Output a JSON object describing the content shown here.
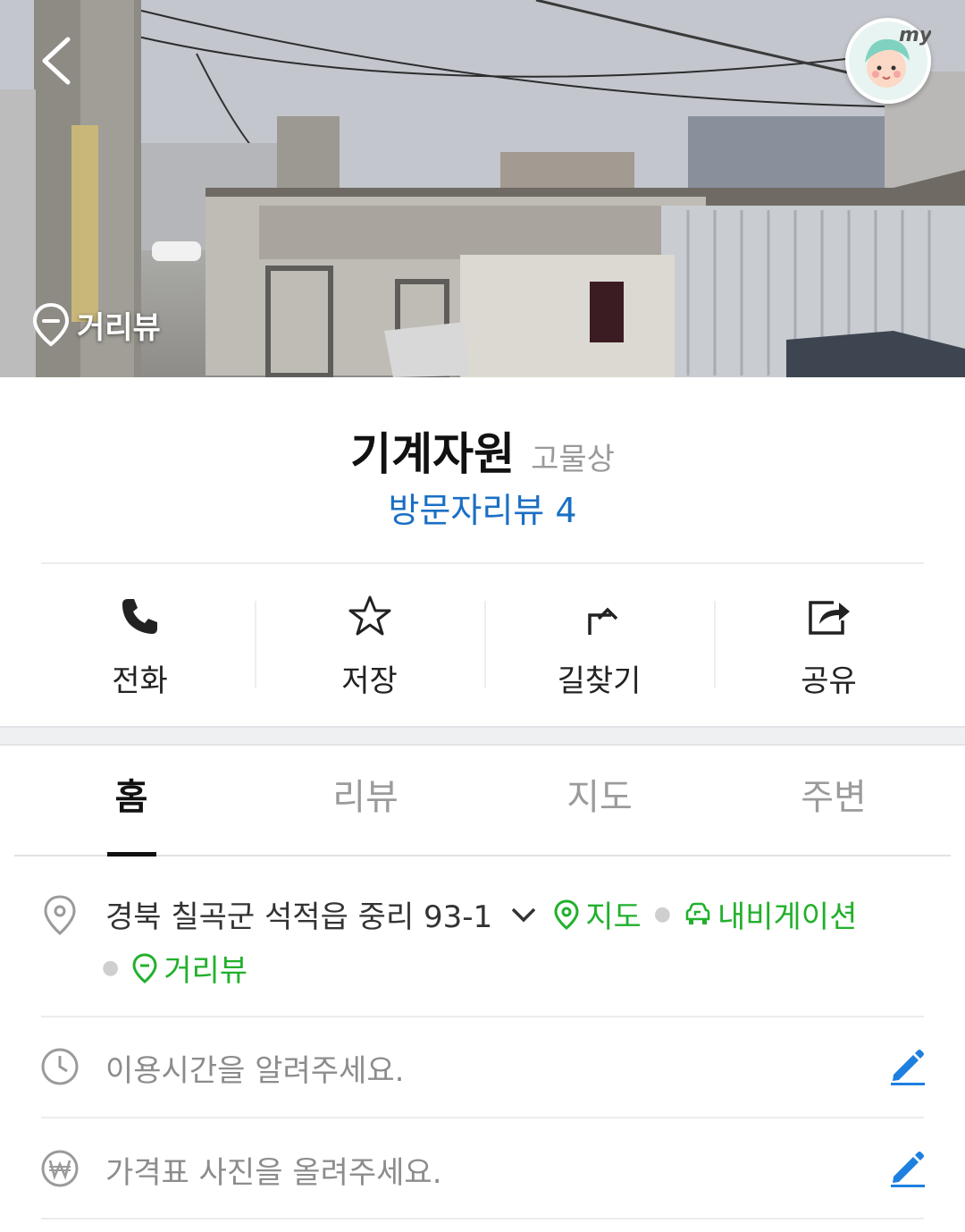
{
  "hero": {
    "streetview_label": "거리뷰",
    "my_badge": "my"
  },
  "place": {
    "name": "기계자원",
    "category": "고물상",
    "review_link": "방문자리뷰 4"
  },
  "actions": [
    {
      "label": "전화",
      "icon": "phone-icon"
    },
    {
      "label": "저장",
      "icon": "star-icon"
    },
    {
      "label": "길찾기",
      "icon": "directions-icon"
    },
    {
      "label": "공유",
      "icon": "share-icon"
    }
  ],
  "tabs": [
    {
      "label": "홈",
      "active": true
    },
    {
      "label": "리뷰",
      "active": false
    },
    {
      "label": "지도",
      "active": false
    },
    {
      "label": "주변",
      "active": false
    }
  ],
  "address": {
    "text": "경북 칠곡군 석적읍 중리 93-1",
    "map_link": "지도",
    "navigation_link": "내비게이션",
    "streetview_link": "거리뷰"
  },
  "hours": {
    "prompt": "이용시간을 알려주세요."
  },
  "price": {
    "prompt": "가격표 사진을 올려주세요."
  },
  "colors": {
    "link_blue": "#1a6fc4",
    "link_green": "#22b02c",
    "edit_blue": "#1e7fe0"
  }
}
